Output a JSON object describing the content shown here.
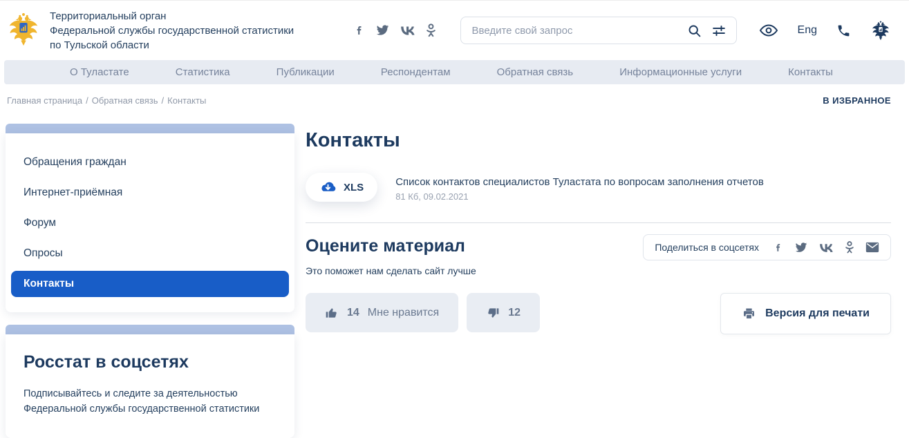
{
  "header": {
    "org_lines": {
      "0": "Территориальный орган",
      "1": "Федеральной службы государственной статистики",
      "2": "по Тульской области"
    },
    "search_placeholder": "Введите свой запрос",
    "lang_label": "Eng"
  },
  "nav": {
    "items": {
      "0": "О Туластате",
      "1": "Статистика",
      "2": "Публикации",
      "3": "Респондентам",
      "4": "Обратная связь",
      "5": "Информационные услуги",
      "6": "Контакты"
    }
  },
  "breadcrumb": {
    "items": {
      "0": "Главная страница",
      "1": "Обратная связь",
      "2": "Контакты"
    },
    "separator": "/"
  },
  "favorite_label": "В ИЗБРАННОЕ",
  "sidebar": {
    "menu": {
      "0": "Обращения граждан",
      "1": "Интернет-приёмная",
      "2": "Форум",
      "3": "Опросы",
      "4": "Контакты"
    },
    "active_item": "Контакты",
    "social_block": {
      "title": "Росстат в соцсетях",
      "line1": "Подписывайтесь и следите за деятельностью",
      "line2": "Федеральной службы государственной статистики"
    }
  },
  "main": {
    "title": "Контакты",
    "file": {
      "badge": "XLS",
      "title": "Список контактов специалистов Туластата по вопросам заполнения отчетов",
      "meta": "81 Кб, 09.02.2021"
    },
    "rate": {
      "title": "Оцените материал",
      "subtitle": "Это поможет нам сделать сайт лучше",
      "like_count": "14",
      "like_label": "Мне нравится",
      "dislike_count": "12"
    },
    "share_label": "Поделиться в соцсетях",
    "print_label": "Версия для печати"
  },
  "colors": {
    "accent_blue": "#185dc7",
    "navy_text": "#1d3a5f",
    "strip_blue": "#aec1e3",
    "nav_bg": "#e7ebf2",
    "icon_gray": "#5b6b80",
    "button_gray_bg": "#e9edf3",
    "logo_gold": "#f0b52e",
    "shield_blue": "#2f66c2"
  }
}
